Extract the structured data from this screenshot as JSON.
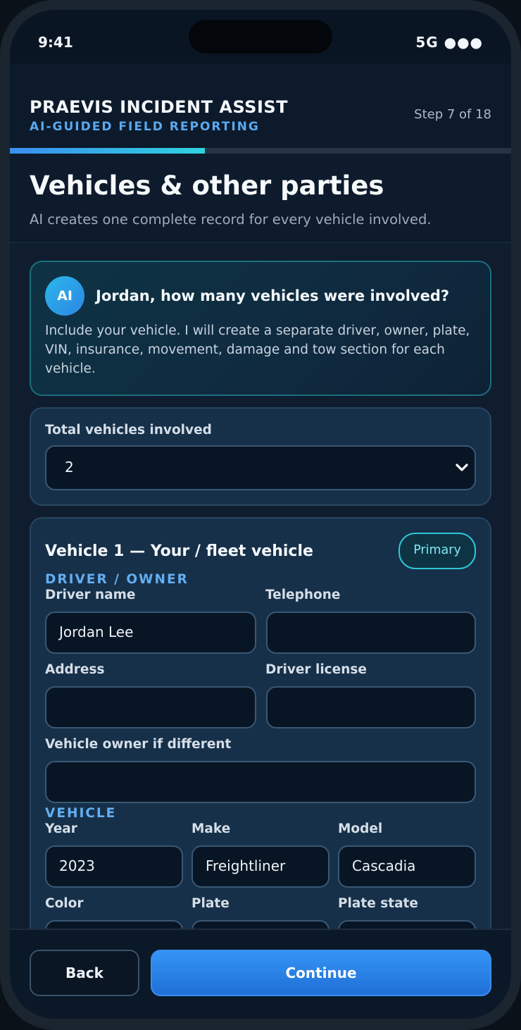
{
  "status_bar": {
    "time": "9:41",
    "network": "5G ●●●"
  },
  "header": {
    "app_title": "PRAEVIS INCIDENT ASSIST",
    "app_subtitle": "AI-GUIDED FIELD REPORTING",
    "step": "Step 7 of 18",
    "progress": 0.389
  },
  "page": {
    "title": "Vehicles & other parties",
    "description": "AI creates one complete record for every vehicle involved."
  },
  "ai_prompt": {
    "badge": "AI",
    "question": "Jordan, how many vehicles were involved?",
    "text": "Include your vehicle. I will create a separate driver, owner, plate, VIN, insurance, movement, damage and tow section for each vehicle."
  },
  "vehicle_count": {
    "label": "Total vehicles involved",
    "value": "2"
  },
  "vehicle_1": {
    "title": "Vehicle 1 — Your / fleet vehicle",
    "badge": "Primary",
    "driver_section": "DRIVER / OWNER",
    "driver_name_label": "Driver name",
    "driver_name_value": "Jordan Lee",
    "telephone_label": "Telephone",
    "telephone_value": "",
    "address_label": "Address",
    "address_value": "",
    "license_label": "Driver license",
    "license_value": "",
    "owner_label": "Vehicle owner if different",
    "owner_value": "",
    "vehicle_section": "VEHICLE",
    "year_label": "Year",
    "year_value": "2023",
    "make_label": "Make",
    "make_value": "Freightliner",
    "model_label": "Model",
    "model_value": "Cascadia",
    "color_label": "Color",
    "plate_label": "Plate",
    "plate_state_label": "Plate state"
  },
  "footer": {
    "back_label": "Back",
    "continue_label": "Continue"
  },
  "colors": {
    "accent": "#3594f5",
    "ai_accent": "#2fc6d6",
    "background": "#0f1d2e"
  },
  "icons": {
    "select_chevron": "chevron-down-icon"
  }
}
